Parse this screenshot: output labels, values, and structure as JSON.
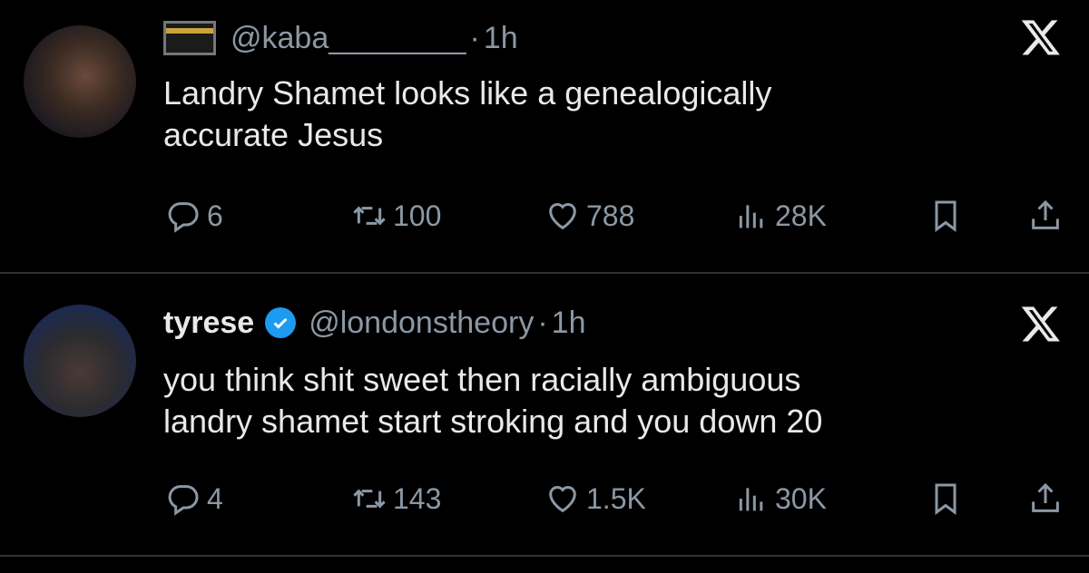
{
  "tweets": [
    {
      "display_name": "",
      "handle": "@kaba________",
      "separator": "·",
      "time": "1h",
      "text_lines": [
        "Landry Shamet looks like a genealogically",
        "accurate Jesus"
      ],
      "verified": false,
      "name_emoji": "kaaba-icon",
      "stats": {
        "replies": "6",
        "retweets": "100",
        "likes": "788",
        "views": "28K"
      }
    },
    {
      "display_name": "tyrese",
      "handle": "@londonstheory",
      "separator": "·",
      "time": "1h",
      "text_lines": [
        "you think shit sweet then racially ambiguous",
        "landry shamet start stroking and you down 20"
      ],
      "verified": true,
      "stats": {
        "replies": "4",
        "retweets": "143",
        "likes": "1.5K",
        "views": "30K"
      }
    }
  ],
  "colors": {
    "background": "#000000",
    "text_primary": "#e7e9ea",
    "text_secondary": "#8b98a5",
    "verified_blue": "#1d9bf0",
    "divider": "#2f3336"
  }
}
